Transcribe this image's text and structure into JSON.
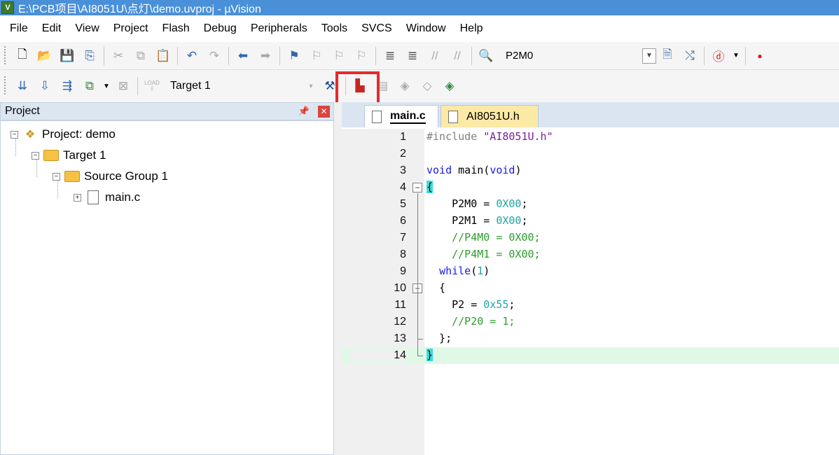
{
  "window": {
    "title": "E:\\PCB项目\\AI8051U\\点灯\\demo.uvproj - µVision",
    "icon": "keil-uvision-icon"
  },
  "menu": [
    "File",
    "Edit",
    "View",
    "Project",
    "Flash",
    "Debug",
    "Peripherals",
    "Tools",
    "SVCS",
    "Window",
    "Help"
  ],
  "toolbar": {
    "find_text": "P2M0",
    "target_name": "Target 1",
    "load_label": "LOAD"
  },
  "project_pane": {
    "title": "Project",
    "tree": {
      "project": "Project: demo",
      "target": "Target 1",
      "group": "Source Group 1",
      "file": "main.c"
    }
  },
  "editor": {
    "tabs": [
      {
        "label": "main.c",
        "active": true
      },
      {
        "label": "AI8051U.h",
        "active": false
      }
    ],
    "lines": [
      {
        "n": "1",
        "tokens": [
          [
            "pp",
            "#include "
          ],
          [
            "str",
            "\"AI8051U.h\""
          ]
        ]
      },
      {
        "n": "2",
        "tokens": []
      },
      {
        "n": "3",
        "tokens": [
          [
            "kw",
            "void"
          ],
          [
            "",
            " main("
          ],
          [
            "kw",
            "void"
          ],
          [
            "",
            ")"
          ]
        ]
      },
      {
        "n": "4",
        "tokens": [
          [
            "brace",
            "{"
          ]
        ]
      },
      {
        "n": "5",
        "tokens": [
          [
            "",
            "    P2M0 = "
          ],
          [
            "num",
            "0X00"
          ],
          [
            "",
            ";"
          ]
        ]
      },
      {
        "n": "6",
        "tokens": [
          [
            "",
            "    P2M1 = "
          ],
          [
            "num",
            "0X00"
          ],
          [
            "",
            ";"
          ]
        ]
      },
      {
        "n": "7",
        "tokens": [
          [
            "cm",
            "    //P4M0 = 0X00;"
          ]
        ]
      },
      {
        "n": "8",
        "tokens": [
          [
            "cm",
            "    //P4M1 = 0X00;"
          ]
        ]
      },
      {
        "n": "9",
        "tokens": [
          [
            "",
            "  "
          ],
          [
            "kw",
            "while"
          ],
          [
            "",
            "("
          ],
          [
            "num",
            "1"
          ],
          [
            "",
            ")"
          ]
        ]
      },
      {
        "n": "10",
        "tokens": [
          [
            "",
            "  {"
          ]
        ]
      },
      {
        "n": "11",
        "tokens": [
          [
            "",
            "    P2 = "
          ],
          [
            "num",
            "0x55"
          ],
          [
            "",
            ";"
          ]
        ]
      },
      {
        "n": "12",
        "tokens": [
          [
            "cm",
            "    //P20 = 1;"
          ]
        ]
      },
      {
        "n": "13",
        "tokens": [
          [
            "",
            "  };"
          ]
        ]
      },
      {
        "n": "14",
        "tokens": [
          [
            "brace",
            "}"
          ]
        ]
      }
    ],
    "current_line": "14",
    "fold_lines": [
      "4",
      "10"
    ]
  },
  "colors": {
    "title_bar": "#4a90d9",
    "highlight_box": "#e8282c",
    "current_line": "#dff9e6",
    "brace_match": "#34e0e0"
  }
}
